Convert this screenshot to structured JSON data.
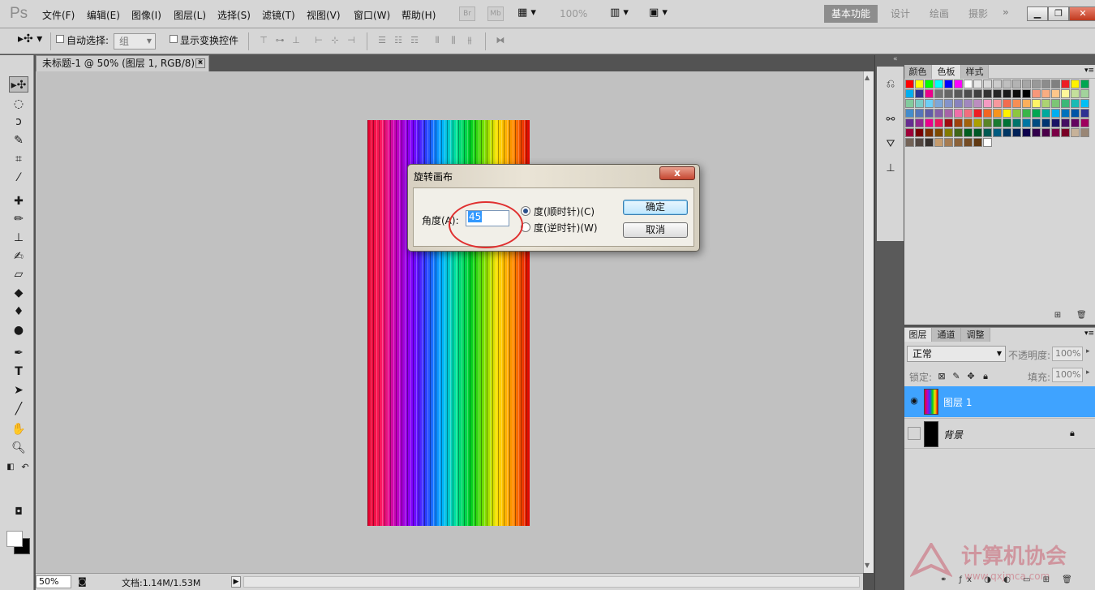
{
  "app": {
    "logo": "Ps"
  },
  "menu": [
    "文件(F)",
    "编辑(E)",
    "图像(I)",
    "图层(L)",
    "选择(S)",
    "滤镜(T)",
    "视图(V)",
    "窗口(W)",
    "帮助(H)"
  ],
  "menubar": {
    "bridge": "Br",
    "minibridge": "Mb",
    "zoom": "100%"
  },
  "workspaces": {
    "active": "基本功能",
    "items": [
      "设计",
      "绘画",
      "摄影"
    ]
  },
  "options": {
    "auto_select": "自动选择:",
    "auto_select_value": "组",
    "show_transform": "显示变换控件"
  },
  "document": {
    "tab_title": "未标题-1 @ 50% (图层 1, RGB/8) *"
  },
  "status": {
    "zoom": "50%",
    "doc_info": "文档:1.14M/1.53M"
  },
  "swatch_panel": {
    "tabs": [
      "颜色",
      "色板",
      "样式"
    ],
    "active_tab": "色板",
    "rows": [
      [
        "#ff0000",
        "#ffff00",
        "#00ff00",
        "#00ffff",
        "#0000ff",
        "#ff00ff",
        "#ffffff",
        "#e6e6e6",
        "#d9d9d9",
        "#cccccc",
        "#bfbfbf",
        "#b3b3b3",
        "#a6a6a6",
        "#999999",
        "#8c8c8c",
        "#808080",
        "#ed1c24",
        "#fff200",
        "#00a651"
      ],
      [
        "#00aeef",
        "#2e3192",
        "#ec008c",
        "#737373",
        "#666666",
        "#595959",
        "#4d4d4d",
        "#404040",
        "#333333",
        "#262626",
        "#1a1a1a",
        "#0d0d0d",
        "#000000",
        "#f7977a",
        "#f9ad81",
        "#fdc68a",
        "#fff79a",
        "#c4df9b",
        "#a2d39c"
      ],
      [
        "#82ca9d",
        "#7bcdc8",
        "#6ecff6",
        "#7ea7d8",
        "#8493ca",
        "#8882be",
        "#a187be",
        "#bc8dbf",
        "#f49ac2",
        "#f6989d",
        "#f26c4f",
        "#f68e55",
        "#fbaf5c",
        "#fff467",
        "#acd372",
        "#7cc576",
        "#3bb878",
        "#1abbb4",
        "#00bff3"
      ],
      [
        "#438ccb",
        "#5574b9",
        "#605ca8",
        "#855fa8",
        "#a763a8",
        "#f06ea9",
        "#f26d7d",
        "#ed1c24",
        "#f26522",
        "#f7941d",
        "#fff200",
        "#8dc63f",
        "#39b54a",
        "#00a651",
        "#00a99d",
        "#00aeef",
        "#0072bc",
        "#0054a6",
        "#2e3192"
      ],
      [
        "#662d91",
        "#92278f",
        "#ec008c",
        "#ed145b",
        "#9e0b0f",
        "#a0410d",
        "#a36209",
        "#aba000",
        "#598527",
        "#1a7b30",
        "#007236",
        "#00746b",
        "#0076a3",
        "#004b80",
        "#003471",
        "#1b1464",
        "#440e62",
        "#630460",
        "#9e005d"
      ],
      [
        "#9e0039",
        "#790000",
        "#7b2e00",
        "#7d4900",
        "#827b00",
        "#406618",
        "#005e20",
        "#005826",
        "#005952",
        "#005b7f",
        "#003663",
        "#002157",
        "#0d004c",
        "#32004b",
        "#4b0049",
        "#7b0046",
        "#7a0026",
        "#c7b299",
        "#998675"
      ],
      [
        "#736357",
        "#534741",
        "#37302d",
        "#c69c6e",
        "#a67c52",
        "#8c6239",
        "#754c24",
        "#603913",
        "#ffffff"
      ]
    ]
  },
  "layers_panel": {
    "tabs": [
      "图层",
      "通道",
      "调整"
    ],
    "blend_mode": "正常",
    "opacity_label": "不透明度:",
    "opacity": "100%",
    "lock_label": "锁定:",
    "fill_label": "填充:",
    "fill": "100%",
    "layers": [
      {
        "name": "图层 1",
        "selected": true,
        "visible": true
      },
      {
        "name": "背景",
        "selected": false,
        "visible": false,
        "locked": true
      }
    ]
  },
  "dialog": {
    "title": "旋转画布",
    "close": "x",
    "angle_label": "角度(A):",
    "angle_value": "45",
    "radio_cw": "度(顺时针)(C)",
    "radio_ccw": "度(逆时针)(W)",
    "ok": "确定",
    "cancel": "取消"
  },
  "watermark": {
    "text": "计算机协会",
    "url": "www.qxjmca.com"
  }
}
